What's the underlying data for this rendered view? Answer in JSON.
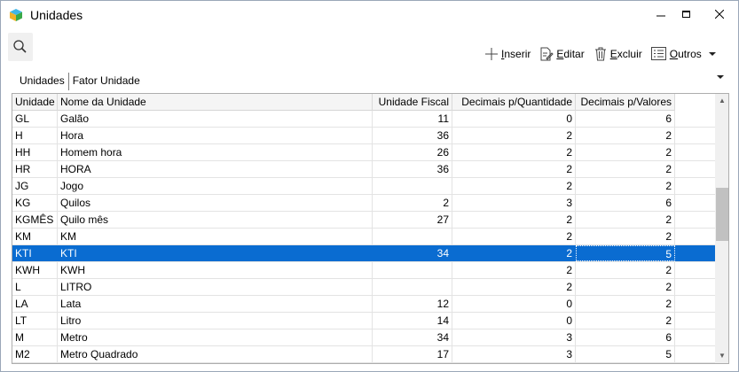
{
  "window": {
    "title": "Unidades",
    "minimize_icon": "minimize-icon",
    "maximize_icon": "maximize-icon",
    "close_icon": "close-icon"
  },
  "toolbar": {
    "insert": {
      "accel": "I",
      "rest": "nserir"
    },
    "edit": {
      "accel": "E",
      "rest": "ditar"
    },
    "delete": {
      "accel": "E",
      "rest": "xcluir"
    },
    "others": {
      "accel": "O",
      "rest": "utros"
    }
  },
  "tabs": [
    "Unidades",
    "Fator Unidade"
  ],
  "grid": {
    "headers": [
      "Unidade",
      "Nome da Unidade",
      "Unidade Fiscal",
      "Decimais p/Quantidade",
      "Decimais p/Valores"
    ],
    "rows": [
      [
        "GL",
        "Galão",
        "11",
        "0",
        "6"
      ],
      [
        "H",
        "Hora",
        "36",
        "2",
        "2"
      ],
      [
        "HH",
        "Homem hora",
        "26",
        "2",
        "2"
      ],
      [
        "HR",
        "HORA",
        "36",
        "2",
        "2"
      ],
      [
        "JG",
        "Jogo",
        "",
        "2",
        "2"
      ],
      [
        "KG",
        "Quilos",
        "2",
        "3",
        "6"
      ],
      [
        "KGMÊS",
        "Quilo mês",
        "27",
        "2",
        "2"
      ],
      [
        "KM",
        "KM",
        "",
        "2",
        "2"
      ],
      [
        "KTI",
        "KTI",
        "34",
        "2",
        "5"
      ],
      [
        "KWH",
        "KWH",
        "",
        "2",
        "2"
      ],
      [
        "L",
        "LITRO",
        "",
        "2",
        "2"
      ],
      [
        "LA",
        "Lata",
        "12",
        "0",
        "2"
      ],
      [
        "LT",
        "Litro",
        "14",
        "0",
        "2"
      ],
      [
        "M",
        "Metro",
        "34",
        "3",
        "6"
      ],
      [
        "M2",
        "Metro Quadrado",
        "17",
        "3",
        "5"
      ]
    ],
    "selected_row": 8
  },
  "colors": {
    "selection": "#0a6cd1",
    "header_bg": "#f5f5f5"
  }
}
